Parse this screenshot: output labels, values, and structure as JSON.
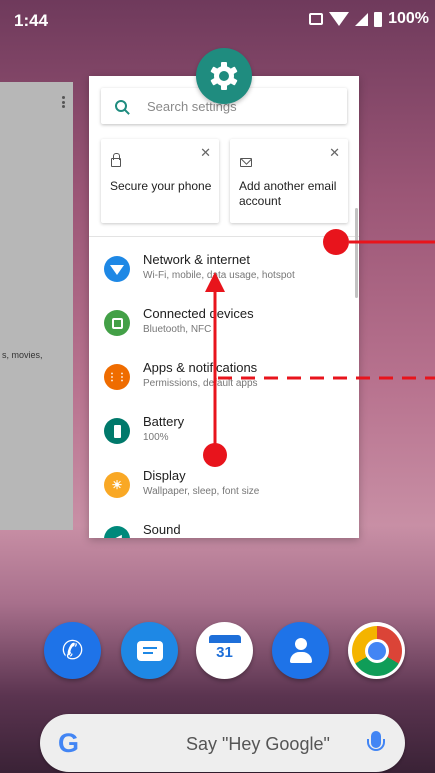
{
  "status_bar": {
    "time": "1:44",
    "battery": "100%"
  },
  "settings_card": {
    "search_placeholder": "Search settings",
    "suggestions": [
      {
        "icon": "lock-icon",
        "label": "Secure your phone"
      },
      {
        "icon": "email-icon",
        "label": "Add another email account"
      }
    ],
    "items": [
      {
        "title": "Network & internet",
        "subtitle": "Wi-Fi, mobile, data usage, hotspot",
        "color": "#1e88e5"
      },
      {
        "title": "Connected devices",
        "subtitle": "Bluetooth, NFC",
        "color": "#43a047"
      },
      {
        "title": "Apps & notifications",
        "subtitle": "Permissions, default apps",
        "color": "#ef6c00"
      },
      {
        "title": "Battery",
        "subtitle": "100%",
        "color": "#00796b"
      },
      {
        "title": "Display",
        "subtitle": "Wallpaper, sleep, font size",
        "color": "#f9a825"
      },
      {
        "title": "Sound",
        "subtitle": "",
        "color": "#00897b"
      }
    ]
  },
  "left_card": {
    "snippet": "s, movies,"
  },
  "dock": {
    "calendar_day": "31"
  },
  "google_search": {
    "logo": "G",
    "hint": "Say \"Hey Google\""
  }
}
